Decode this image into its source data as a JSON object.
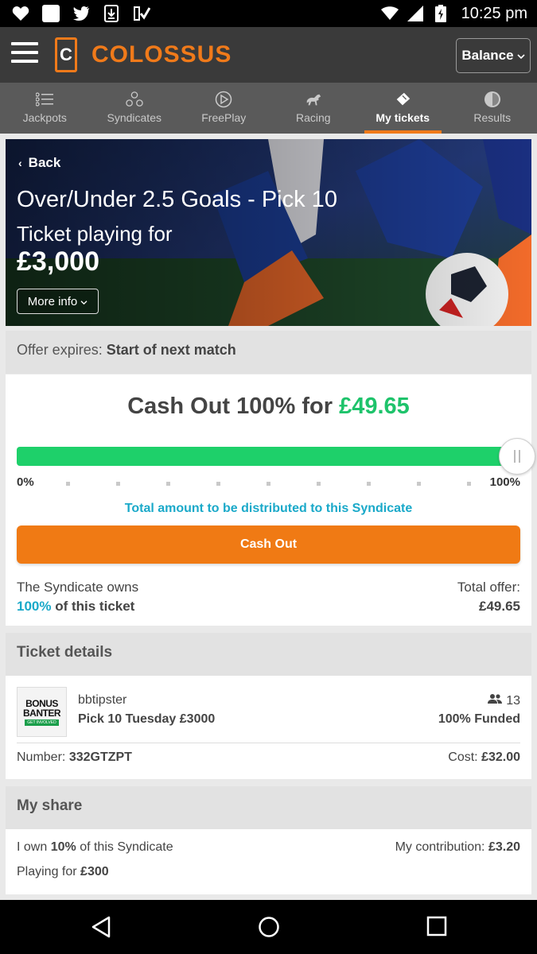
{
  "status_bar": {
    "time": "10:25 pm",
    "left_icons": [
      "heart-icon",
      "square-icon",
      "twitter-icon",
      "download-icon",
      "checklist-icon"
    ],
    "right_icons": [
      "wifi-icon",
      "signal-icon",
      "battery-charging-icon"
    ]
  },
  "header": {
    "brand": "COLOSSUS",
    "logo_letter": "C",
    "balance_label": "Balance"
  },
  "nav_tabs": [
    {
      "label": "Jackpots",
      "icon": "list-icon"
    },
    {
      "label": "Syndicates",
      "icon": "syndicate-icon"
    },
    {
      "label": "FreePlay",
      "icon": "play-circle-icon"
    },
    {
      "label": "Racing",
      "icon": "horse-icon"
    },
    {
      "label": "My tickets",
      "icon": "ticket-icon",
      "active": true
    },
    {
      "label": "Results",
      "icon": "results-icon"
    }
  ],
  "hero": {
    "back_label": "Back",
    "title": "Over/Under 2.5 Goals - Pick 10",
    "playing_label": "Ticket playing for",
    "amount": "£3,000",
    "more_info_label": "More info"
  },
  "offer": {
    "label": "Offer expires:",
    "value": "Start of next match"
  },
  "cashout": {
    "title_prefix": "Cash Out 100% for",
    "title_amount": "£49.65",
    "slider_percent": 100,
    "slider_min_label": "0%",
    "slider_max_label": "100%",
    "distribution_note": "Total amount to be distributed to this Syndicate",
    "button_label": "Cash Out",
    "owns_label": "The Syndicate owns",
    "owns_percent": "100%",
    "owns_suffix": "of this ticket",
    "total_offer_label": "Total offer:",
    "total_offer_value": "£49.65"
  },
  "ticket_details": {
    "heading": "Ticket details",
    "logo_line1": "BONUS",
    "logo_line2": "BANTER",
    "logo_line3": "GET INVOLVED",
    "syndicate_name": "bbtipster",
    "pick_name": "Pick 10 Tuesday £3000",
    "members": "13",
    "funded": "100% Funded",
    "number_label": "Number:",
    "number_value": "332GTZPT",
    "cost_label": "Cost:",
    "cost_value": "£32.00"
  },
  "my_share": {
    "heading": "My share",
    "own_prefix": "I own",
    "own_percent": "10%",
    "own_suffix": "of this Syndicate",
    "contribution_label": "My contribution:",
    "contribution_value": "£3.20",
    "playing_label": "Playing for",
    "playing_value": "£300"
  },
  "colors": {
    "accent_orange": "#f07a14",
    "cashout_green": "#1ec36b",
    "teal": "#1aa9c9",
    "header_bg": "#3a3a3a",
    "nav_bg": "#5a5a5a"
  }
}
